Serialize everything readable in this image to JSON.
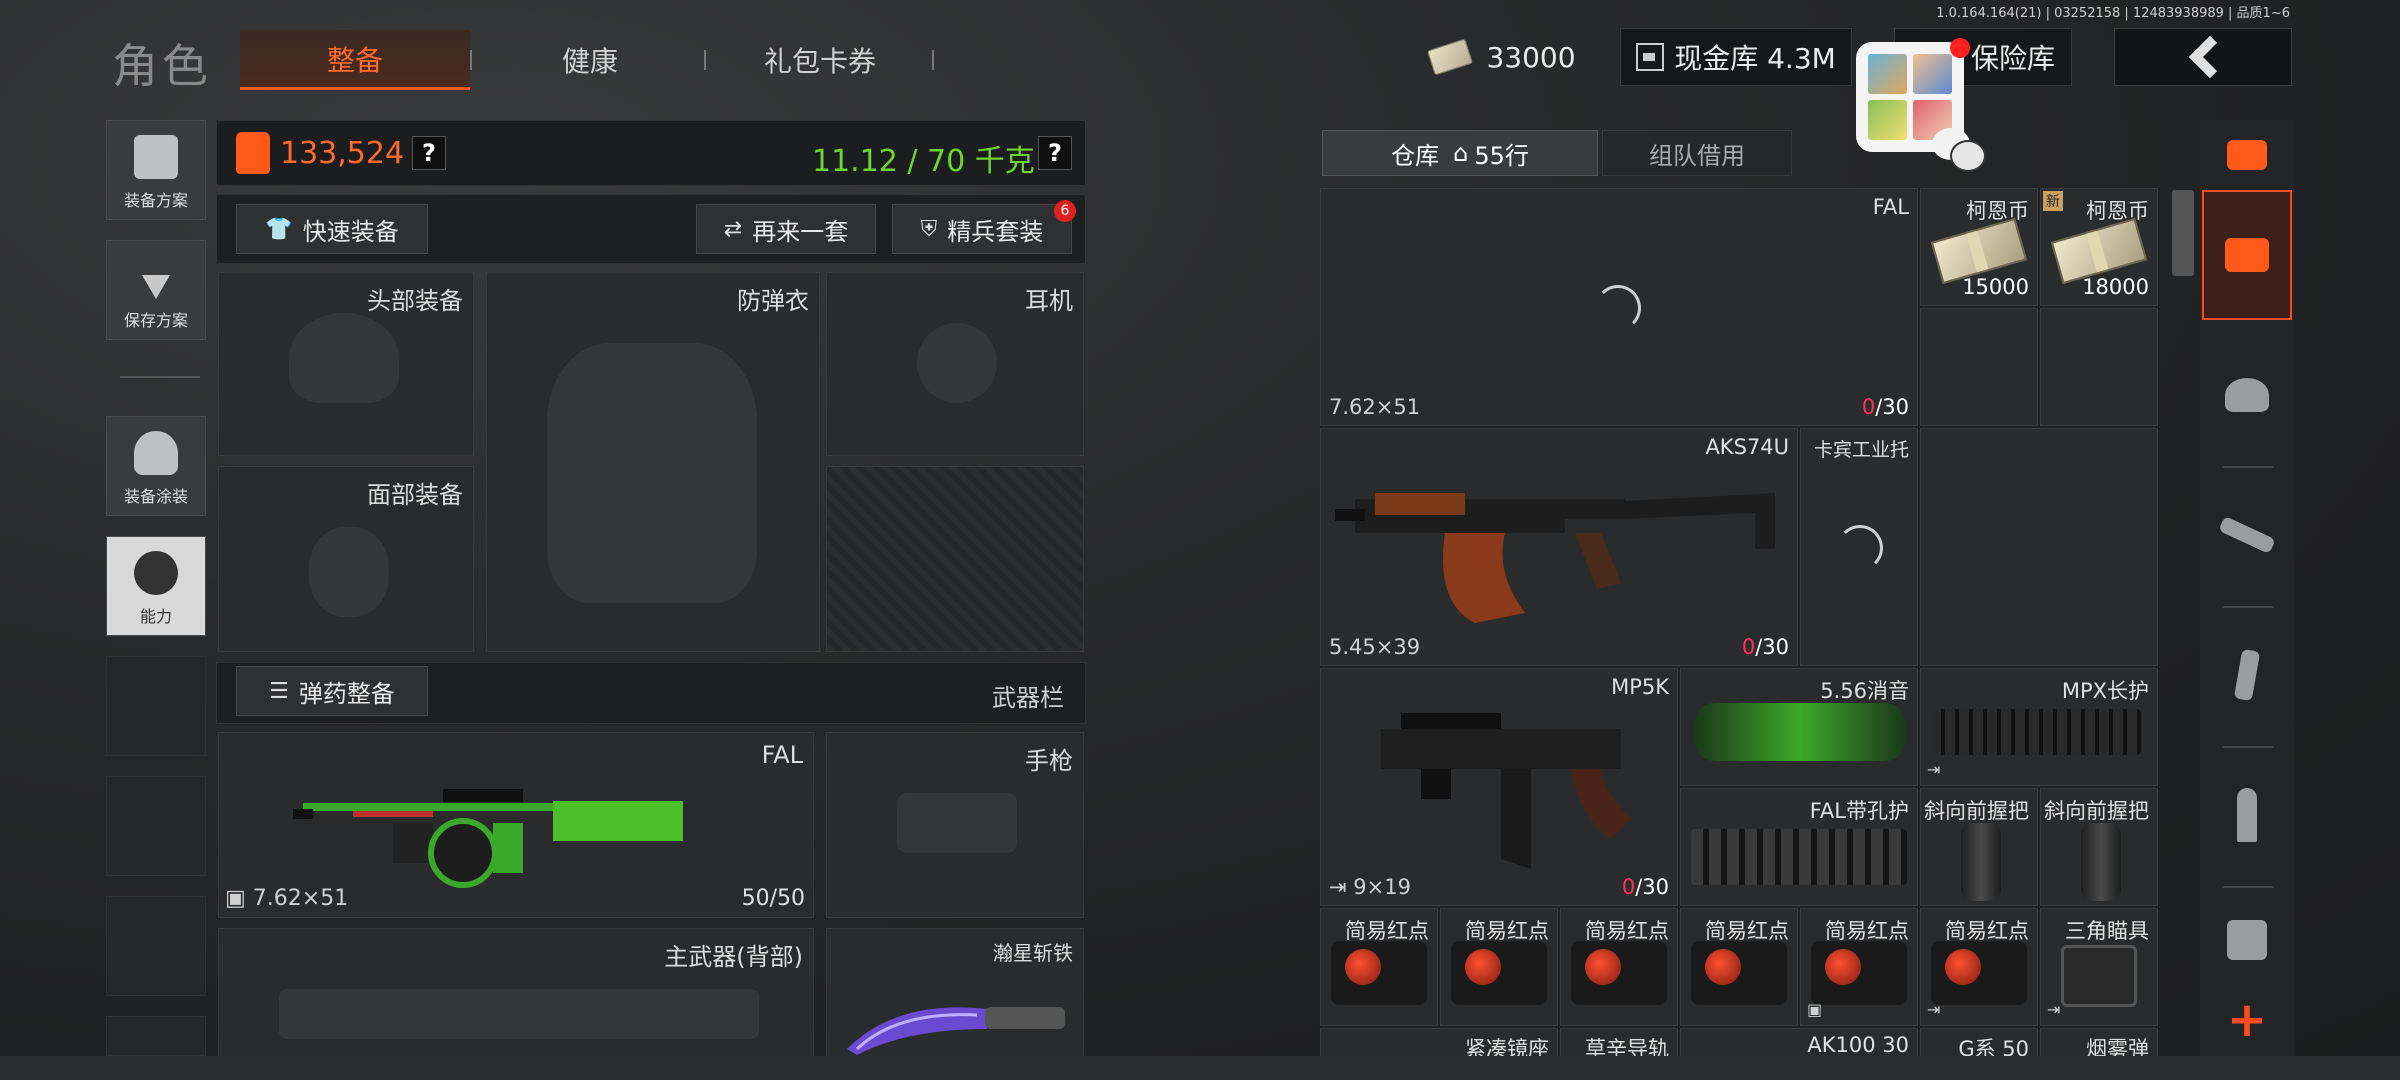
{
  "version": "1.0.164.164(21) | 03252158 | 12483938989 | 品质1~6",
  "header": {
    "title": "角色",
    "tabs": [
      {
        "label": "整备",
        "active": true
      },
      {
        "label": "健康",
        "active": false
      },
      {
        "label": "礼包卡券",
        "active": false
      }
    ],
    "currency": "33000",
    "cash_vault": "现金库 4.3M",
    "safe_vault": "保险库"
  },
  "sidebar": {
    "items": [
      {
        "label": "装备方案",
        "icon": "vest-icon"
      },
      {
        "label": "保存方案",
        "icon": "download-icon"
      },
      {
        "label": "装备涂装",
        "icon": "helmet-paint-icon"
      },
      {
        "label": "能力",
        "icon": "lightning-icon"
      }
    ]
  },
  "stats": {
    "armor_value": "133,524",
    "weight": "11.12 / 70 千克",
    "help": "?"
  },
  "actions": {
    "quick_equip": "快速装备",
    "redo_set": "再来一套",
    "elite_set": "精兵套装",
    "elite_badge": "6"
  },
  "slots": {
    "head": "头部装备",
    "body_armor": "防弹衣",
    "headset": "耳机",
    "face": "面部装备",
    "ammo_prep": "弹药整备",
    "weapon_bar": "武器栏",
    "primary_name": "FAL",
    "primary_caliber": "7.62×51",
    "primary_ammo": "50/50",
    "pistol": "手枪",
    "back_weapon": "主武器(背部)",
    "melee": "瀚星斩铁"
  },
  "warehouse": {
    "tab_storage": "仓库",
    "rows": "55行",
    "tab_team": "组队借用",
    "items": {
      "fal": {
        "name": "FAL",
        "caliber": "7.62×51",
        "loaded": "0",
        "cap": "/30"
      },
      "coin1": {
        "name": "柯恩币",
        "value": "15000"
      },
      "coin2": {
        "name": "柯恩币",
        "value": "18000",
        "badge": "新"
      },
      "aks": {
        "name": "AKS74U",
        "caliber": "5.45×39",
        "loaded": "0",
        "cap": "/30"
      },
      "stock": {
        "name": "卡宾工业托"
      },
      "mp5k": {
        "name": "MP5K",
        "caliber": "9×19",
        "loaded": "0",
        "cap": "/30"
      },
      "suppressor": {
        "name": "5.56消音"
      },
      "mpx": {
        "name": "MPX长护"
      },
      "falguard": {
        "name": "FAL带孔护"
      },
      "grip1": {
        "name": "斜向前握把"
      },
      "grip2": {
        "name": "斜向前握把"
      },
      "reddots": [
        "简易红点",
        "简易红点",
        "简易红点",
        "简易红点",
        "简易红点",
        "简易红点"
      ],
      "triangle": "三角瞄具",
      "bottom_row": [
        "紧凑镜座",
        "草辛导轨",
        "AK100 30",
        "G系 50",
        "烟雾弹"
      ]
    }
  },
  "colors": {
    "accent": "#ff5a1a",
    "weight_green": "#6ed42e",
    "zero_red": "#ff3060"
  }
}
